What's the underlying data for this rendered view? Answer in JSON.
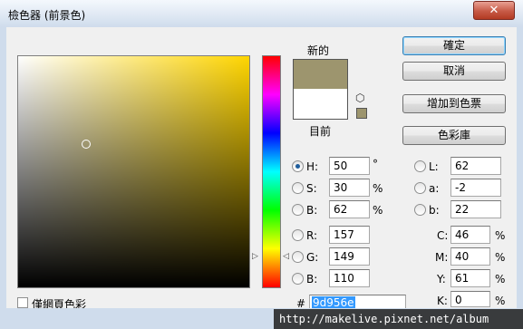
{
  "window": {
    "title": "檢色器 (前景色)",
    "close_glyph": "✕"
  },
  "preview": {
    "new_label": "新的",
    "current_label": "目前",
    "new_color": "#9d956e",
    "current_color": "#ffffff",
    "cube_icon": "gamut-cube-icon"
  },
  "buttons": {
    "ok": "確定",
    "cancel": "取消",
    "add_to_swatches": "增加到色票",
    "color_libraries": "色彩庫"
  },
  "hsb": {
    "h": {
      "label": "H:",
      "value": "50",
      "unit": "°"
    },
    "s": {
      "label": "S:",
      "value": "30",
      "unit": "%"
    },
    "b": {
      "label": "B:",
      "value": "62",
      "unit": "%"
    }
  },
  "rgb": {
    "r": {
      "label": "R:",
      "value": "157"
    },
    "g": {
      "label": "G:",
      "value": "149"
    },
    "b": {
      "label": "B:",
      "value": "110"
    }
  },
  "lab": {
    "l": {
      "label": "L:",
      "value": "62"
    },
    "a": {
      "label": "a:",
      "value": "-2"
    },
    "b": {
      "label": "b:",
      "value": "22"
    }
  },
  "cmyk": {
    "c": {
      "label": "C:",
      "value": "46",
      "unit": "%"
    },
    "m": {
      "label": "M:",
      "value": "40",
      "unit": "%"
    },
    "y": {
      "label": "Y:",
      "value": "61",
      "unit": "%"
    },
    "k": {
      "label": "K:",
      "value": "0",
      "unit": "%"
    }
  },
  "hex": {
    "label": "#",
    "value": "9d956e"
  },
  "web_only": {
    "label": "僅網頁色彩",
    "checked": false
  },
  "hue_base_color": "#ffd500",
  "watermark": "http://makelive.pixnet.net/album"
}
